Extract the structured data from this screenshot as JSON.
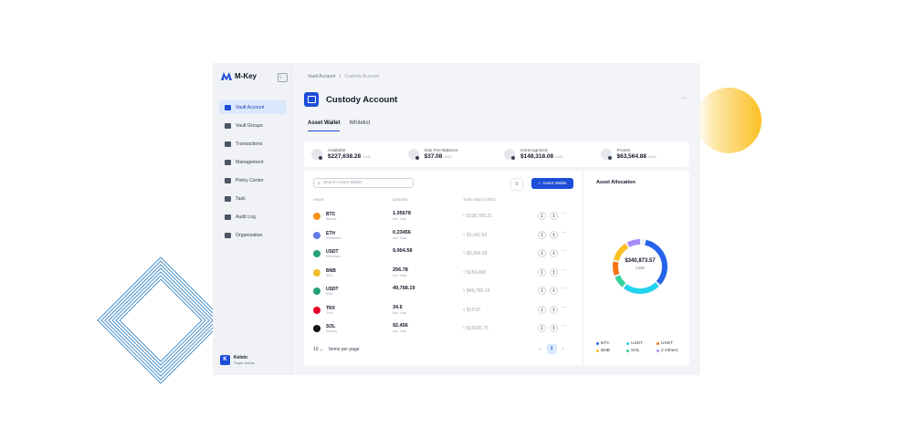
{
  "app": {
    "brand": "M-Key",
    "collapse_icon": "sidebar-collapse-icon"
  },
  "sidebar": {
    "items": [
      {
        "label": "Vault Account",
        "icon": "vault-icon",
        "active": true
      },
      {
        "label": "Vault Groups",
        "icon": "groups-icon",
        "active": false
      },
      {
        "label": "Transactions",
        "icon": "transactions-icon",
        "active": false
      },
      {
        "label": "Management",
        "icon": "management-icon",
        "active": false
      },
      {
        "label": "Policy Center",
        "icon": "shield-icon",
        "active": false
      },
      {
        "label": "Task",
        "icon": "task-icon",
        "active": false
      },
      {
        "label": "Audit Log",
        "icon": "audit-icon",
        "active": false
      },
      {
        "label": "Organization",
        "icon": "organization-icon",
        "active": false
      }
    ]
  },
  "user": {
    "initial": "K",
    "name": "Kelvin",
    "role": "Super Admin"
  },
  "header": {
    "breadcrumb_root": "Vault Account",
    "breadcrumb_sep": "/",
    "breadcrumb_current": "Custody Account",
    "title": "Custody Account",
    "more": "···"
  },
  "tabs": [
    {
      "label": "Asset Wallet",
      "active": true
    },
    {
      "label": "Whitelist",
      "active": false
    }
  ],
  "summary": [
    {
      "label": "Available",
      "value": "$227,638.28",
      "unit": "USD"
    },
    {
      "label": "Gas Fee Balance",
      "value": "$37.08",
      "unit": "USD"
    },
    {
      "label": "Unrecognized",
      "value": "$148,318.08",
      "unit": "USD"
    },
    {
      "label": "Frozen",
      "value": "$63,564.88",
      "unit": "USD"
    }
  ],
  "toolbar": {
    "search_placeholder": "Search Asset Wallet",
    "add_label": "Asset Wallet",
    "add_icon": "+"
  },
  "table": {
    "headers": {
      "asset": "Asset",
      "quantity": "Quantity",
      "total": "Total Value (USD)"
    },
    "rows": [
      {
        "symbol": "BTC",
        "network": "Bitcoin",
        "qty": "1.05678",
        "qty_sub": "Incl. Gas",
        "total": "≈ $130,789.21",
        "color": "#f7931a"
      },
      {
        "symbol": "ETH",
        "network": "Ethereum",
        "qty": "0.23456",
        "qty_sub": "Incl. Gas",
        "total": "≈ $1,041.62",
        "color": "#627eea"
      },
      {
        "symbol": "USDT",
        "network": "Ethereum",
        "qty": "9,904.58",
        "qty_sub": "",
        "total": "≈ $9,904.58",
        "color": "#26a17b"
      },
      {
        "symbol": "BNB",
        "network": "BSC",
        "qty": "256.78",
        "qty_sub": "Incl. Gas",
        "total": "≈ $154,068",
        "color": "#f3ba2f"
      },
      {
        "symbol": "USDT",
        "network": "BSC",
        "qty": "49,768.19",
        "qty_sub": "",
        "total": "≈ $49,768.19",
        "color": "#26a17b"
      },
      {
        "symbol": "TRX",
        "network": "Tron",
        "qty": "34.6",
        "qty_sub": "Incl. Gas",
        "total": "≈ $10.07",
        "color": "#eb0029"
      },
      {
        "symbol": "SOL",
        "network": "Solana",
        "qty": "92.456",
        "qty_sub": "Incl. Gas",
        "total": "≈ $10105.75",
        "color": "#111111"
      }
    ]
  },
  "pagination": {
    "page_size": "10",
    "page_size_label": "Items per page",
    "current": "1",
    "prev": "‹",
    "next": "›"
  },
  "allocation": {
    "title": "Asset Allocation",
    "total": "$340,873.57",
    "unit": "USD",
    "legend": [
      {
        "label": "BTC",
        "color": "#2563eb"
      },
      {
        "label": "USDT",
        "color": "#22d3ee"
      },
      {
        "label": "USDT",
        "color": "#f97316"
      },
      {
        "label": "BNB",
        "color": "#fbbf24"
      },
      {
        "label": "SOL",
        "color": "#34d399"
      },
      {
        "label": "2 Others",
        "color": "#a78bfa"
      }
    ]
  }
}
